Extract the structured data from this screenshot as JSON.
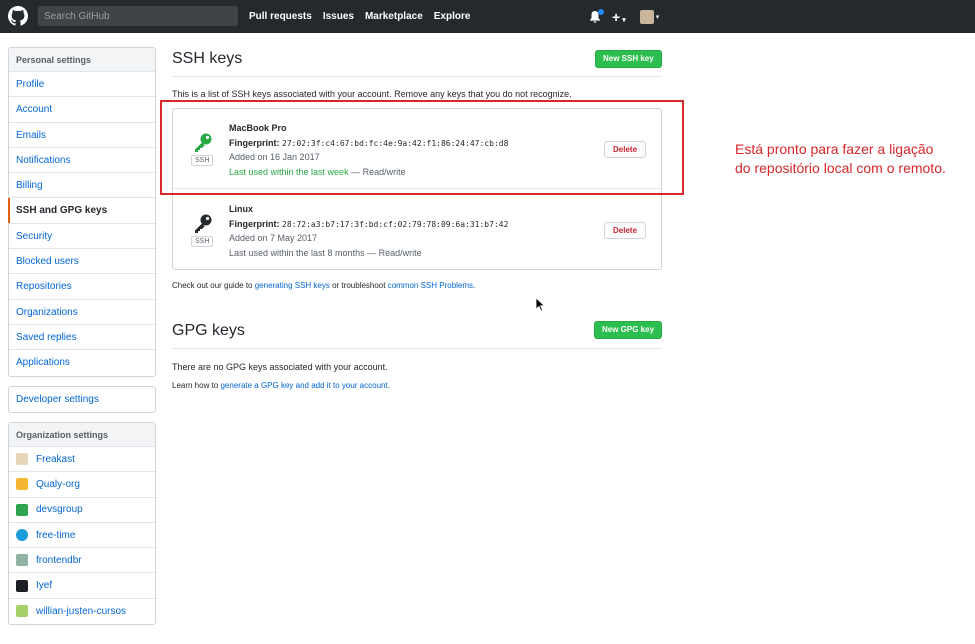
{
  "header": {
    "search_placeholder": "Search GitHub",
    "nav": [
      "Pull requests",
      "Issues",
      "Marketplace",
      "Explore"
    ],
    "icons": [
      "github-logo",
      "bell-icon",
      "plus-icon",
      "avatar"
    ]
  },
  "sidebar": {
    "personal_heading": "Personal settings",
    "items": [
      "Profile",
      "Account",
      "Emails",
      "Notifications",
      "Billing",
      "SSH and GPG keys",
      "Security",
      "Blocked users",
      "Repositories",
      "Organizations",
      "Saved replies",
      "Applications"
    ],
    "selected": "SSH and GPG keys",
    "developer_settings": "Developer settings",
    "org_heading": "Organization settings",
    "orgs": [
      {
        "name": "Freakast",
        "color": "#e8d6b8"
      },
      {
        "name": "Qualy-org",
        "color": "#f5b731"
      },
      {
        "name": "devsgroup",
        "color": "#2ea44f"
      },
      {
        "name": "free-time",
        "color": "#1b9bd7"
      },
      {
        "name": "frontendbr",
        "color": "#8fb3a0"
      },
      {
        "name": "Iyef",
        "color": "#1b1f23"
      },
      {
        "name": "willian-justen-cursos",
        "color": "#a5d06a"
      }
    ]
  },
  "ssh": {
    "title": "SSH keys",
    "new_button": "New SSH key",
    "intro": "This is a list of SSH keys associated with your account. Remove any keys that you do not recognize.",
    "keys": [
      {
        "name": "MacBook Pro",
        "fingerprint_label": "Fingerprint:",
        "fingerprint": "27:02:3f:c4:67:bd:fc:4e:9a:42:f1:86:24:47:cb:d8",
        "added": "Added on 16 Jan 2017",
        "used": "Last used within the last week",
        "access": " — Read/write",
        "badge": "SSH",
        "delete": "Delete",
        "icon_color": "#28a745"
      },
      {
        "name": "Linux",
        "fingerprint_label": "Fingerprint:",
        "fingerprint": "28:72:a3:b7:17:3f:bd:cf:02:79:78:09:6a:31:b7:42",
        "added": "Added on 7 May 2017",
        "used": "Last used within the last 8 months",
        "access": " — Read/write",
        "badge": "SSH",
        "delete": "Delete",
        "icon_color": "#24292e"
      }
    ],
    "guide_prefix": "Check out our guide to ",
    "guide_link1": "generating SSH keys",
    "guide_middle": " or troubleshoot ",
    "guide_link2": "common SSH Problems",
    "guide_suffix": "."
  },
  "gpg": {
    "title": "GPG keys",
    "new_button": "New GPG key",
    "empty": "There are no GPG keys associated with your account.",
    "learn_prefix": "Learn how to ",
    "learn_link": "generate a GPG key and add it to your account",
    "learn_suffix": "."
  },
  "annotation": {
    "line1": "Está pronto para fazer a ligação",
    "line2": "do repositório local com o remoto."
  },
  "colors": {
    "header_bg": "#24292e",
    "link": "#0366d6",
    "green": "#2cbe4e",
    "danger": "#cb2431",
    "annotation": "#d8262b"
  }
}
